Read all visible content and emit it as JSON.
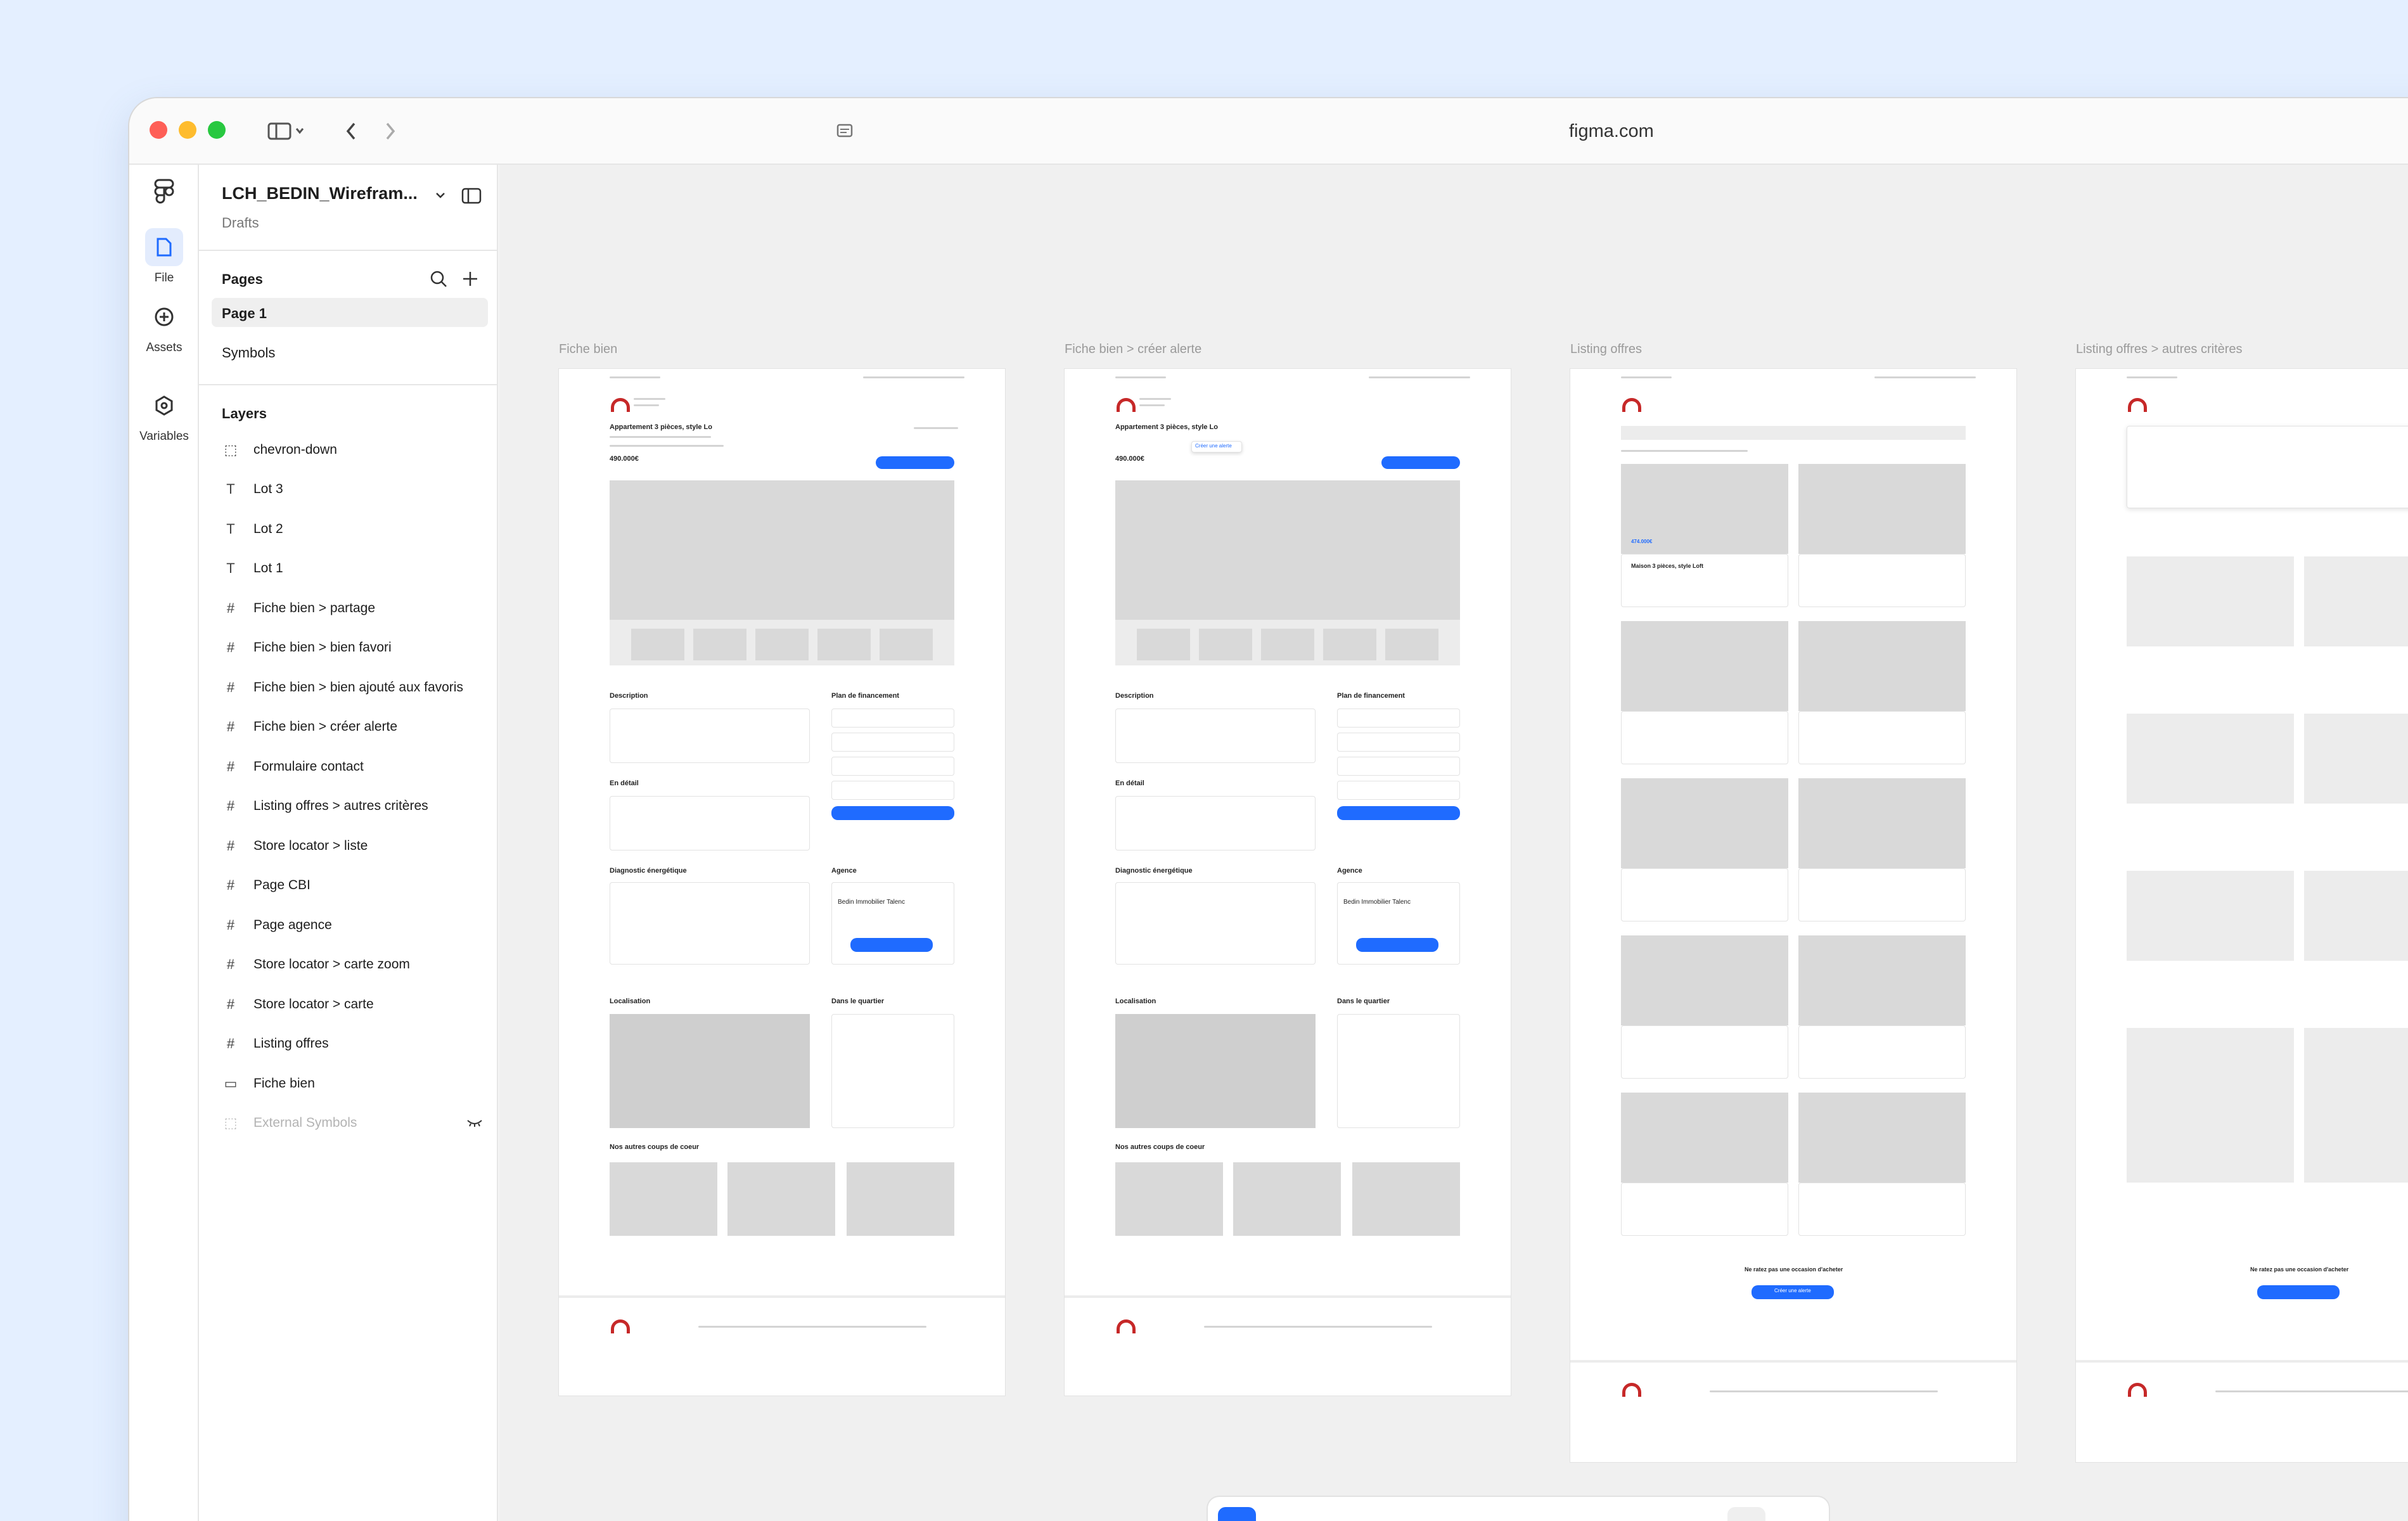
{
  "browser": {
    "url": "figma.com"
  },
  "rail": {
    "file": "File",
    "assets": "Assets",
    "variables": "Variables"
  },
  "file": {
    "name": "LCH_BEDIN_Wirefram...",
    "location": "Drafts"
  },
  "pages": {
    "heading": "Pages",
    "items": [
      "Page 1",
      "Symbols"
    ]
  },
  "layers": {
    "heading": "Layers",
    "items": [
      {
        "label": "chevron-down",
        "icon": "component-dashed-icon"
      },
      {
        "label": "Lot 3",
        "icon": "text-icon"
      },
      {
        "label": "Lot 2",
        "icon": "text-icon"
      },
      {
        "label": "Lot 1",
        "icon": "text-icon"
      },
      {
        "label": "Fiche bien > partage",
        "icon": "frame-icon"
      },
      {
        "label": "Fiche bien > bien favori",
        "icon": "frame-icon"
      },
      {
        "label": "Fiche bien > bien ajouté aux favoris",
        "icon": "frame-icon"
      },
      {
        "label": "Fiche bien > créer alerte",
        "icon": "frame-icon"
      },
      {
        "label": "Formulaire contact",
        "icon": "frame-icon"
      },
      {
        "label": "Listing offres > autres critères",
        "icon": "frame-icon"
      },
      {
        "label": "Store locator > liste",
        "icon": "frame-icon"
      },
      {
        "label": "Page CBI",
        "icon": "frame-icon"
      },
      {
        "label": "Page agence",
        "icon": "frame-icon"
      },
      {
        "label": "Store locator > carte zoom",
        "icon": "frame-icon"
      },
      {
        "label": "Store locator > carte",
        "icon": "frame-icon"
      },
      {
        "label": "Listing offres",
        "icon": "frame-icon"
      },
      {
        "label": "Fiche bien",
        "icon": "rectangle-icon"
      },
      {
        "label": "External Symbols",
        "icon": "component-dashed-icon",
        "muted": true
      }
    ]
  },
  "canvas": {
    "frames": [
      {
        "label": "Fiche bien"
      },
      {
        "label": "Fiche bien > créer alerte"
      },
      {
        "label": "Listing offres"
      },
      {
        "label": "Listing offres > autres critères"
      }
    ]
  },
  "wireframe": {
    "title": "Appartement 3 pièces, style Lo",
    "price": "490.000€",
    "description": "Description",
    "financing": "Plan de financement",
    "detail": "En détail",
    "energy": "Diagnostic énergétique",
    "agency": "Agence",
    "agency_name": "Bedin Immobilier Talenc",
    "location": "Localisation",
    "district": "Dans le quartier",
    "favorites": "Nos autres coups de coeur",
    "card_title": "Maison 3 pièces, style Loft",
    "card_price": "474.000€",
    "listing_card_price": "474.000€",
    "alert_title": "Ne ratez pas une occasion d'acheter",
    "alert_button": "Créer une alerte",
    "create_alert_popup": "Créer une alerte"
  },
  "colors": {
    "accent": "#1f6bff",
    "brand": "#c62828",
    "canvas_bg": "#f0f0f0"
  }
}
